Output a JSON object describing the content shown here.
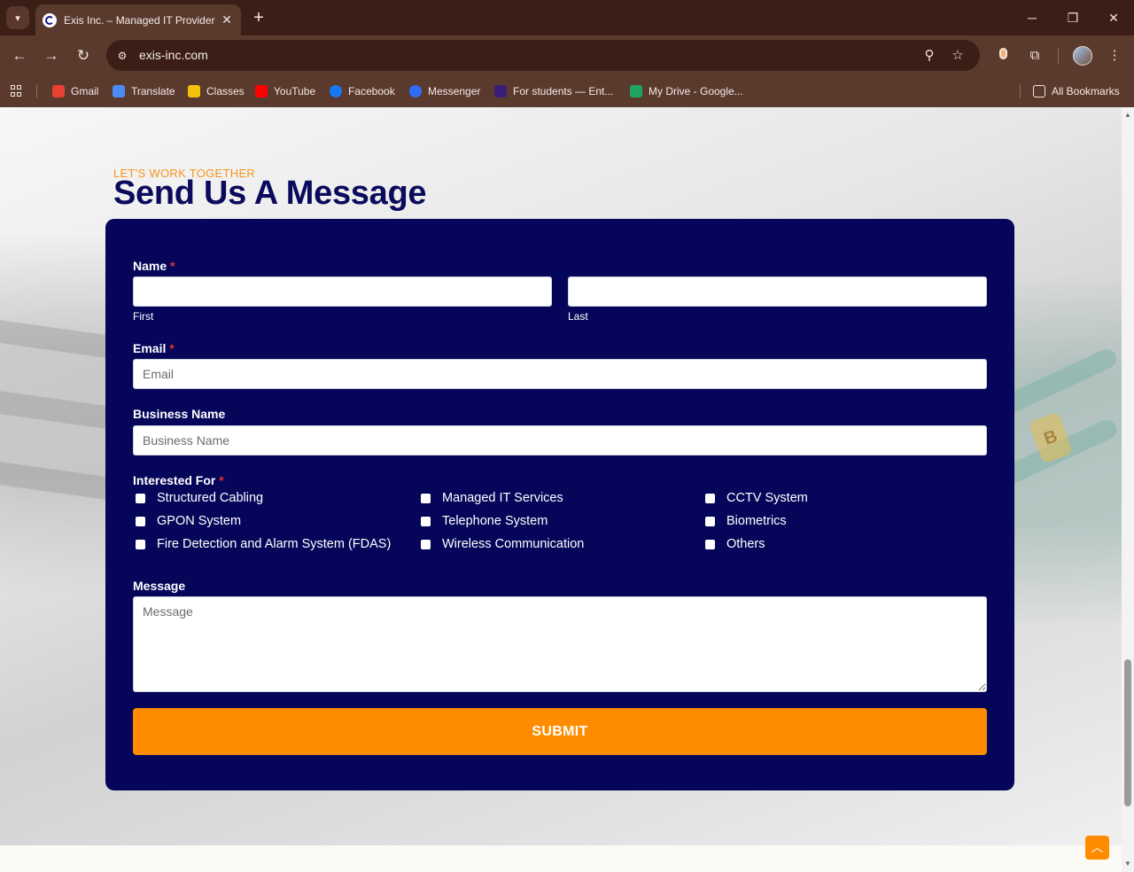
{
  "browser": {
    "tab_title": "Exis Inc. – Managed IT Provider",
    "tab_close": "✕",
    "new_tab": "+",
    "url": "exis-inc.com",
    "bookmarks": [
      {
        "label": "Gmail",
        "icon": "gmail-icon",
        "color": "#e94235"
      },
      {
        "label": "Translate",
        "icon": "translate-icon",
        "color": "#4c8bf5"
      },
      {
        "label": "Classes",
        "icon": "classes-icon",
        "color": "#f4c20d"
      },
      {
        "label": "YouTube",
        "icon": "youtube-icon",
        "color": "#ff0000"
      },
      {
        "label": "Facebook",
        "icon": "facebook-icon",
        "color": "#1877f2"
      },
      {
        "label": "Messenger",
        "icon": "messenger-icon",
        "color": "#2f6df6"
      },
      {
        "label": "For students — Ent...",
        "icon": "quizlet-icon",
        "color": "#3b1e7a"
      },
      {
        "label": "My Drive - Google...",
        "icon": "drive-icon",
        "color": "#1fa463"
      }
    ],
    "all_bookmarks": "All Bookmarks"
  },
  "page": {
    "eyebrow": "LET'S WORK TOGETHER",
    "heading": "Send Us A Message",
    "form": {
      "name_label": "Name",
      "required_mark": "*",
      "first_sublabel": "First",
      "last_sublabel": "Last",
      "email_label": "Email",
      "email_placeholder": "Email",
      "business_label": "Business Name",
      "business_placeholder": "Business Name",
      "interested_label": "Interested For",
      "options": [
        "Structured Cabling",
        "Managed IT Services",
        "CCTV System",
        "GPON System",
        "Telephone System",
        "Biometrics",
        "Fire Detection and Alarm System (FDAS)",
        "Wireless Communication",
        "Others"
      ],
      "message_label": "Message",
      "message_placeholder": "Message",
      "submit_label": "SUBMIT"
    },
    "colors": {
      "accent": "#ff8c00",
      "form_background": "#05065a",
      "heading": "#0b0b5e"
    }
  }
}
